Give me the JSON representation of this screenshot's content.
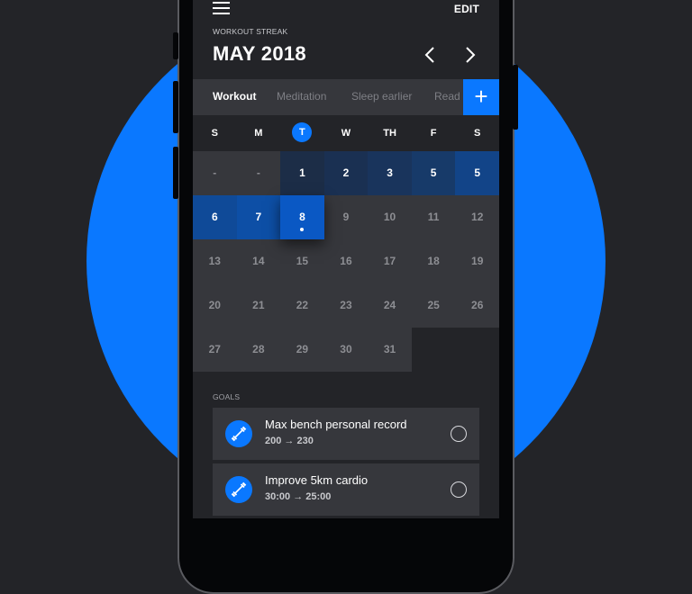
{
  "colors": {
    "accent": "#0a78ff",
    "background": "#232428",
    "card": "#36373c"
  },
  "header": {
    "menu_icon": "hamburger-menu-icon",
    "edit_label": "EDIT",
    "subtitle": "WORKOUT STREAK",
    "month_title": "MAY 2018",
    "prev_icon": "chevron-left-icon",
    "next_icon": "chevron-right-icon"
  },
  "tabs": [
    {
      "label": "Workout",
      "active": true
    },
    {
      "label": "Meditation",
      "active": false
    },
    {
      "label": "Sleep earlier",
      "active": false
    },
    {
      "label": "Read",
      "active": false
    }
  ],
  "add_label": "+",
  "weekdays": [
    "S",
    "M",
    "T",
    "W",
    "TH",
    "F",
    "S"
  ],
  "today_weekday_index": 2,
  "calendar": {
    "rows": [
      [
        {
          "label": "-",
          "type": "blank"
        },
        {
          "label": "-",
          "type": "blank"
        },
        {
          "label": "1",
          "type": "streak",
          "color": "#1c2d47"
        },
        {
          "label": "2",
          "type": "streak",
          "color": "#1a3052"
        },
        {
          "label": "3",
          "type": "streak",
          "color": "#19345c"
        },
        {
          "label": "5",
          "type": "streak",
          "color": "#173a69"
        },
        {
          "label": "5",
          "type": "streak",
          "color": "#124488"
        }
      ],
      [
        {
          "label": "6",
          "type": "streak",
          "color": "#0f4a98"
        },
        {
          "label": "7",
          "type": "streak",
          "color": "#0d4fa6"
        },
        {
          "label": "8",
          "type": "today",
          "color": "#0a58c4"
        },
        {
          "label": "9",
          "type": "day"
        },
        {
          "label": "10",
          "type": "day"
        },
        {
          "label": "11",
          "type": "day"
        },
        {
          "label": "12",
          "type": "day"
        }
      ],
      [
        {
          "label": "13",
          "type": "day"
        },
        {
          "label": "14",
          "type": "day"
        },
        {
          "label": "15",
          "type": "day"
        },
        {
          "label": "16",
          "type": "day"
        },
        {
          "label": "17",
          "type": "day"
        },
        {
          "label": "18",
          "type": "day"
        },
        {
          "label": "19",
          "type": "day"
        }
      ],
      [
        {
          "label": "20",
          "type": "day"
        },
        {
          "label": "21",
          "type": "day"
        },
        {
          "label": "22",
          "type": "day"
        },
        {
          "label": "23",
          "type": "day"
        },
        {
          "label": "24",
          "type": "day"
        },
        {
          "label": "25",
          "type": "day"
        },
        {
          "label": "26",
          "type": "day"
        }
      ],
      [
        {
          "label": "27",
          "type": "day"
        },
        {
          "label": "28",
          "type": "day"
        },
        {
          "label": "29",
          "type": "day"
        },
        {
          "label": "30",
          "type": "day"
        },
        {
          "label": "31",
          "type": "day"
        },
        {
          "label": "",
          "type": "empty"
        },
        {
          "label": "",
          "type": "empty"
        }
      ]
    ]
  },
  "goals": {
    "label": "GOALS",
    "items": [
      {
        "title": "Max bench personal record",
        "progress": "200 → 230",
        "icon": "dumbbell-icon",
        "done": false
      },
      {
        "title": "Improve 5km cardio",
        "progress": "30:00 → 25:00",
        "icon": "dumbbell-icon",
        "done": false
      }
    ]
  }
}
